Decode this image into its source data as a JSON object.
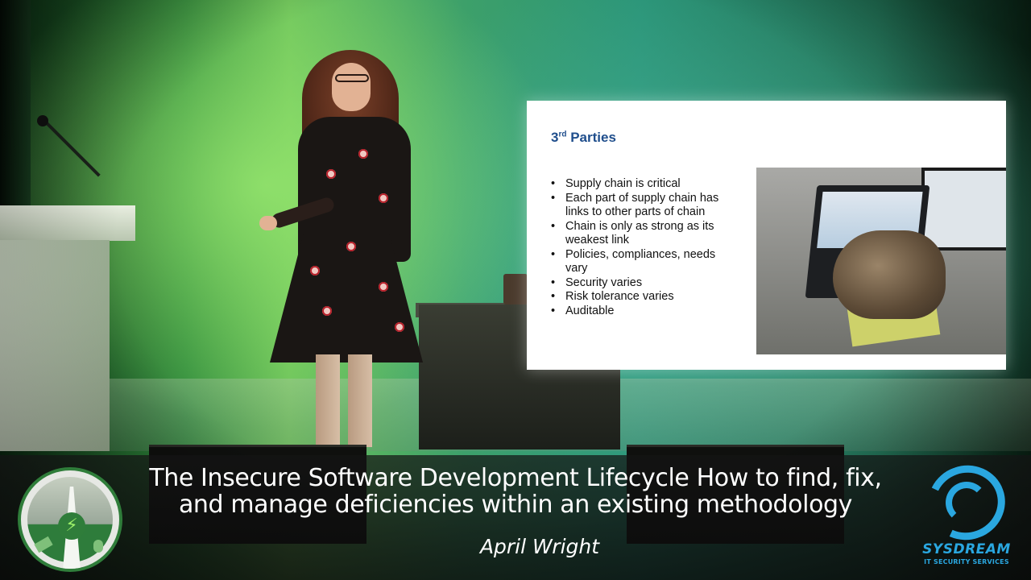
{
  "slide": {
    "title_main": "3",
    "title_sup": "rd",
    "title_rest": " Parties",
    "bullets": [
      "Supply chain is critical",
      "Each part of supply chain has links to other parts of chain",
      "Chain is only as strong as its weakest link",
      "Policies, compliances, needs vary",
      "Security varies",
      "Risk tolerance varies",
      "Auditable"
    ]
  },
  "lower_third": {
    "talk_title_line1": "The Insecure Software Development Lifecycle How to find, fix,",
    "talk_title_line2": "and manage deficiencies within an existing methodology",
    "speaker": "April Wright"
  },
  "logos": {
    "sponsor_name": "SYSDREAM",
    "sponsor_tagline": "IT SECURITY SERVICES",
    "badge_icon": "lightning-bolt-icon"
  },
  "colors": {
    "slide_title": "#1f4e8c",
    "sysdream_blue": "#2aa7e0",
    "badge_green": "#2f7d3a"
  }
}
